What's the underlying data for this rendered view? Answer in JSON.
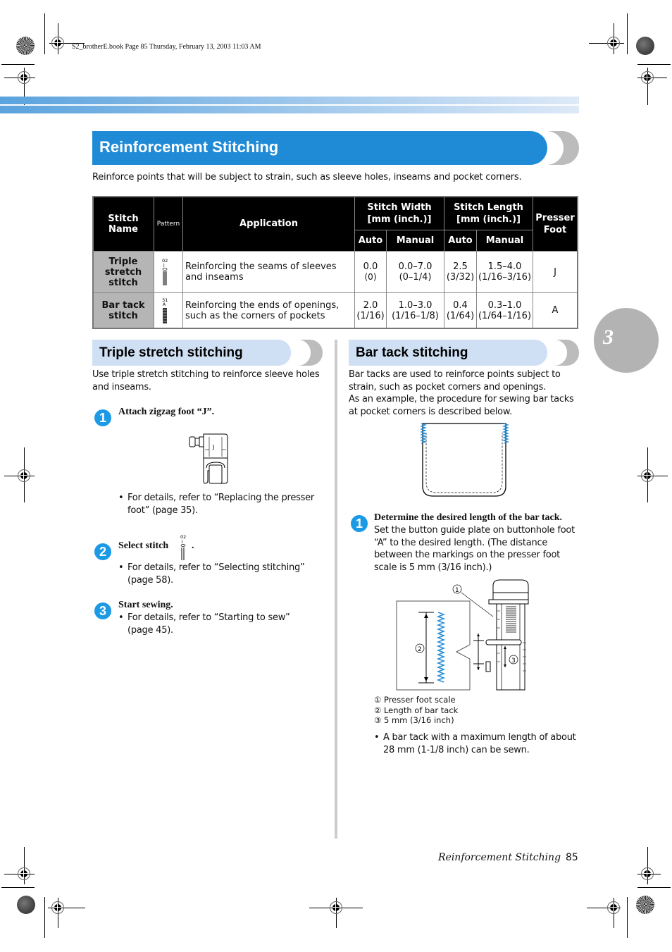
{
  "slug": "S2_brotherE.book  Page 85  Thursday, February 13, 2003  11:03 AM",
  "header": {
    "title": "Reinforcement Stitching",
    "intro": "Reinforce points that will be subject to strain, such as sleeve holes, inseams and pocket corners."
  },
  "chapter_tab": "3",
  "table": {
    "headers": {
      "stitch_name": "Stitch Name",
      "pattern": "Pattern",
      "application": "Application",
      "stitch_width": "Stitch Width",
      "stitch_width_unit": "[mm (inch.)]",
      "stitch_length": "Stitch Length",
      "stitch_length_unit": "[mm (inch.)]",
      "presser_foot_1": "Presser",
      "presser_foot_2": "Foot",
      "auto": "Auto",
      "manual": "Manual"
    },
    "rows": [
      {
        "name_lines": [
          "Triple",
          "stretch",
          "stitch"
        ],
        "pattern_code": "02",
        "pattern_foot": "J",
        "application": "Reinforcing the seams of sleeves and inseams",
        "width_auto": "0.0",
        "width_auto_in": "(0)",
        "width_manual": "0.0–7.0",
        "width_manual_in": "(0–1/4)",
        "length_auto": "2.5",
        "length_auto_in": "(3/32)",
        "length_manual": "1.5–4.0",
        "length_manual_in": "(1/16–3/16)",
        "presser_foot": "J"
      },
      {
        "name_lines": [
          "Bar tack",
          "stitch"
        ],
        "pattern_code": "31",
        "pattern_foot": "A",
        "application": "Reinforcing the ends of openings, such as the corners of pockets",
        "width_auto": "2.0",
        "width_auto_in": "(1/16)",
        "width_manual": "1.0–3.0",
        "width_manual_in": "(1/16–1/8)",
        "length_auto": "0.4",
        "length_auto_in": "(1/64)",
        "length_manual": "0.3–1.0",
        "length_manual_in": "(1/64–1/16)",
        "presser_foot": "A"
      }
    ]
  },
  "triple": {
    "heading": "Triple stretch stitching",
    "intro": "Use triple stretch stitching to reinforce sleeve holes and inseams.",
    "steps": [
      {
        "num": "1",
        "title": "Attach zigzag foot “J”.",
        "foot_label": "J",
        "bullet": "For details, refer to “Replacing the presser foot” (page 35)."
      },
      {
        "num": "2",
        "title": "Select stitch",
        "title_suffix": ".",
        "stitch_code": "02",
        "stitch_foot": "J",
        "bullet": "For details, refer to “Selecting stitching” (page 58)."
      },
      {
        "num": "3",
        "title": "Start sewing.",
        "bullet": "For details, refer to “Starting to sew” (page 45)."
      }
    ]
  },
  "bartack": {
    "heading": "Bar tack stitching",
    "intro_lines": [
      "Bar tacks are used to reinforce points subject to strain, such as pocket corners and openings.",
      "As an example, the procedure for sewing bar tacks at pocket corners is described below."
    ],
    "step": {
      "num": "1",
      "title": "Determine the desired length of the bar tack.",
      "text": "Set the button guide plate on buttonhole foot “A” to the desired length. (The distance between the markings on the presser foot scale is 5 mm (3/16 inch).)"
    },
    "callouts": [
      "①",
      "②",
      "③"
    ],
    "legend": [
      {
        "mark": "①",
        "text": "Presser foot scale"
      },
      {
        "mark": "②",
        "text": "Length of bar tack"
      },
      {
        "mark": "③",
        "text": "5 mm (3/16 inch)"
      }
    ],
    "note": "A bar tack with a maximum length of about 28 mm (1-1/8 inch) can be sewn."
  },
  "footer": {
    "section": "Reinforcement Stitching",
    "page": "85"
  },
  "colors": {
    "title_blue": "#1f8bd6",
    "sub_bg": "#cfe0f4",
    "step_blue": "#1c9ae6",
    "stitch_blue": "#2a8fd8",
    "grey_tab": "#b3b3b3"
  }
}
